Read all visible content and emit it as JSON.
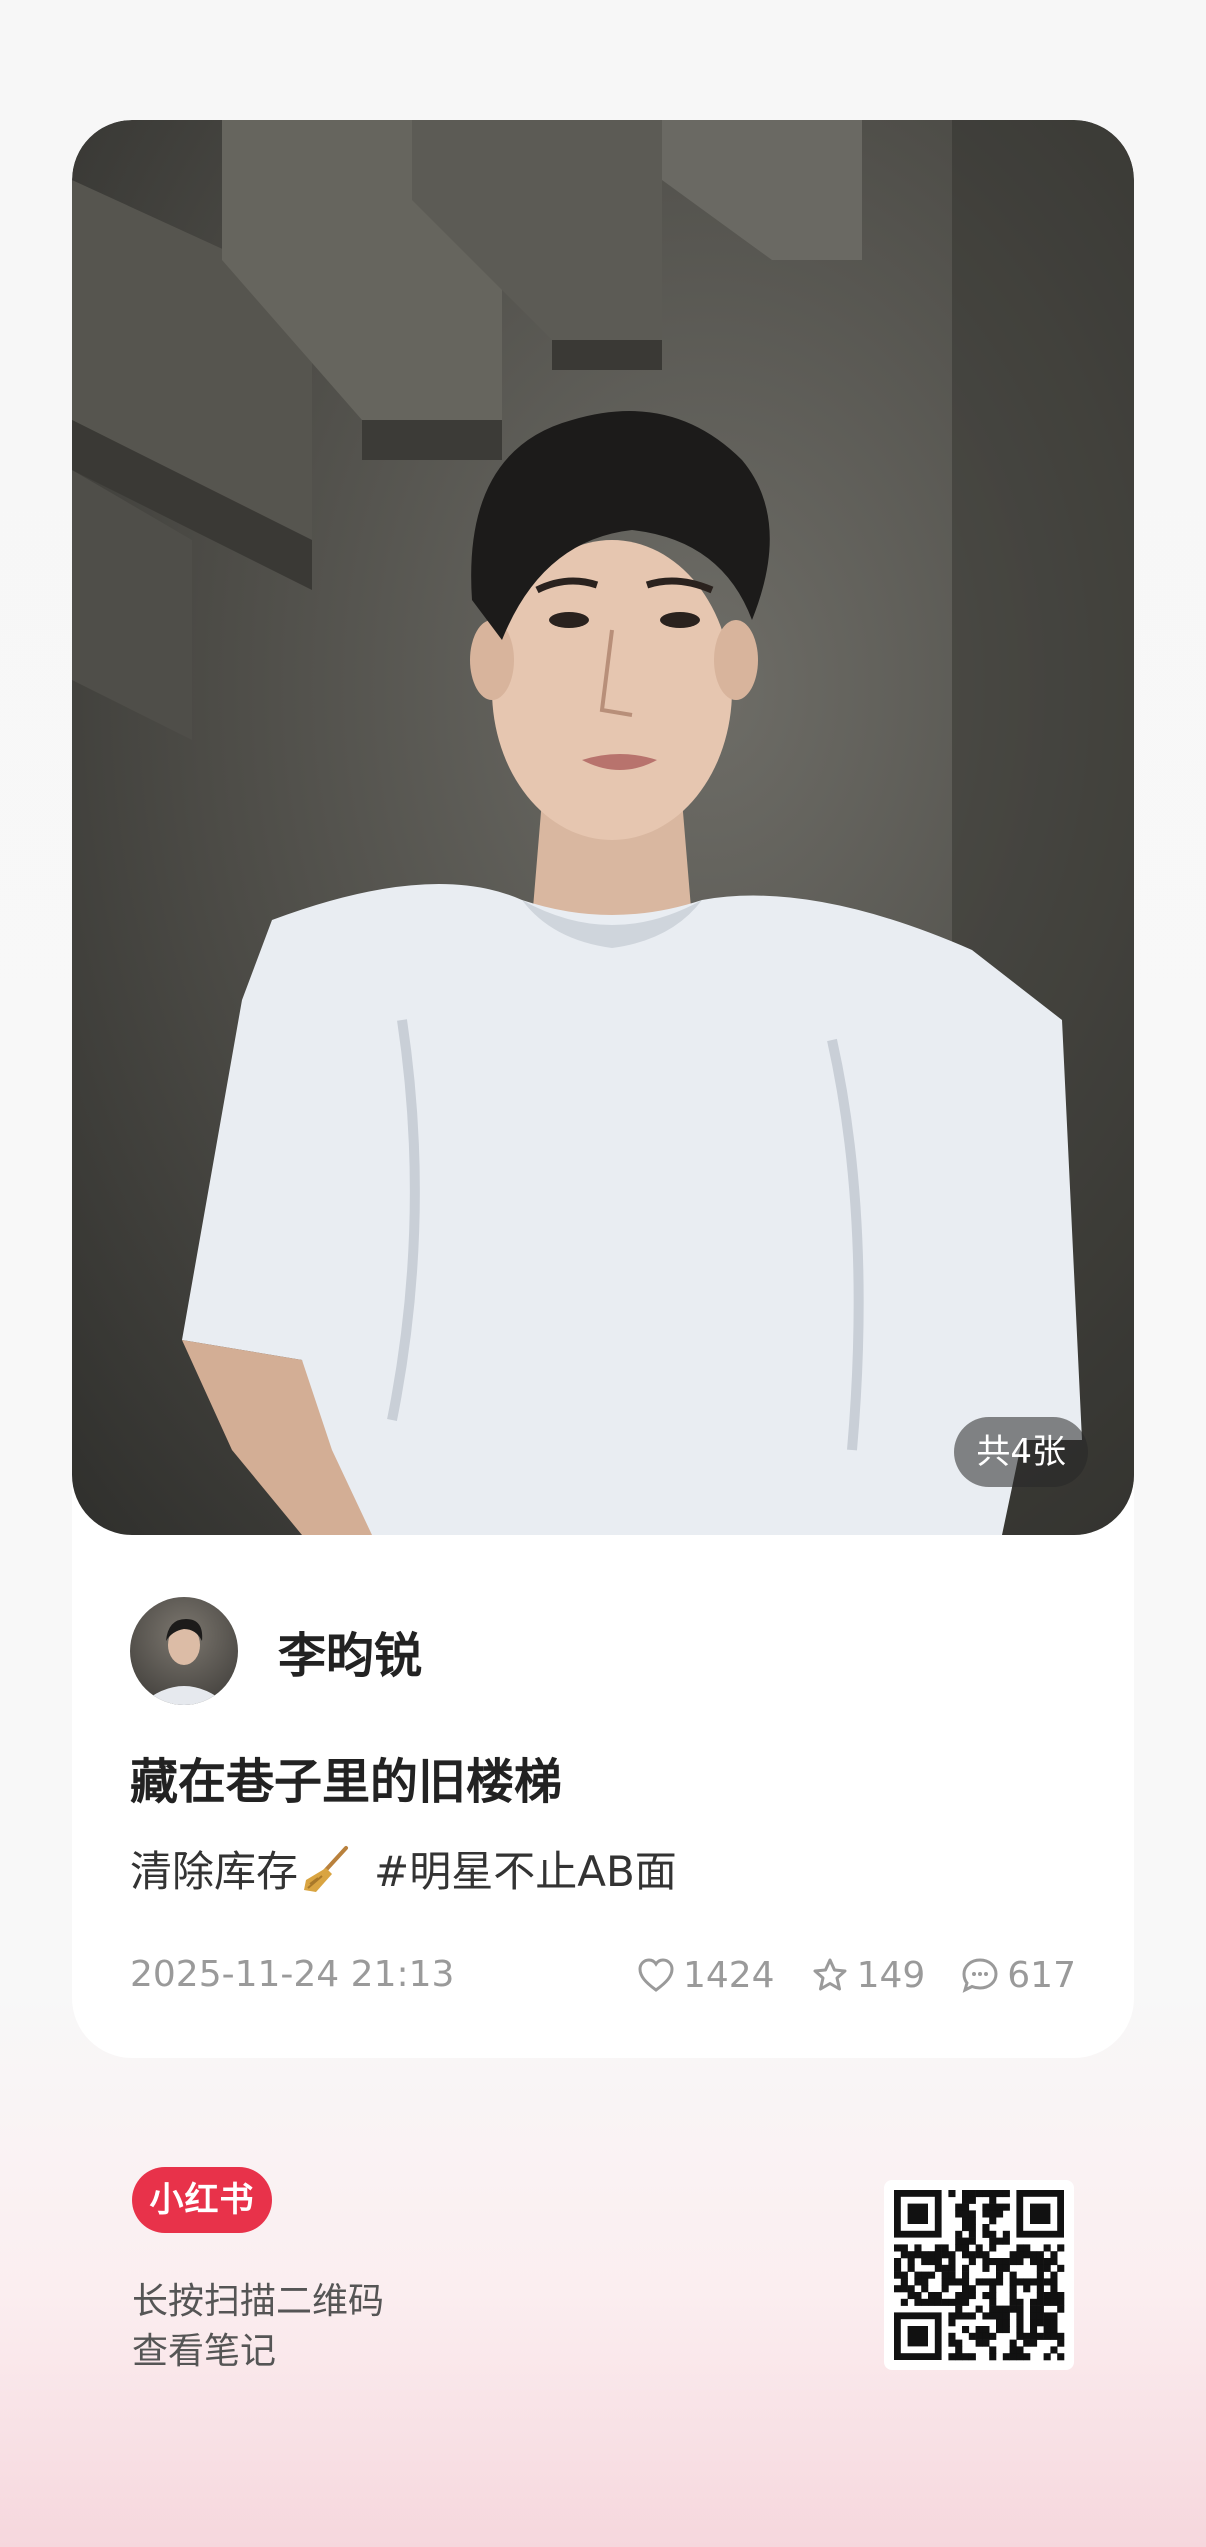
{
  "post": {
    "image_count_label": "共4张",
    "author_name": "李昀锐",
    "title": "藏在巷子里的旧楼梯",
    "description_text": "清除库存",
    "hashtag": "#明星不止AB面",
    "date": "2025-11-24 21:13",
    "likes": "1424",
    "favorites": "149",
    "comments": "617"
  },
  "footer": {
    "brand_label": "小红书",
    "line1": "长按扫描二维码",
    "line2": "查看笔记"
  },
  "icons": {
    "like": "heart-icon",
    "favorite": "star-icon",
    "comment": "chat-bubble-icon",
    "broom": "broom-icon"
  },
  "colors": {
    "brand": "#e8324a",
    "meta_text": "#9a9a9a"
  }
}
